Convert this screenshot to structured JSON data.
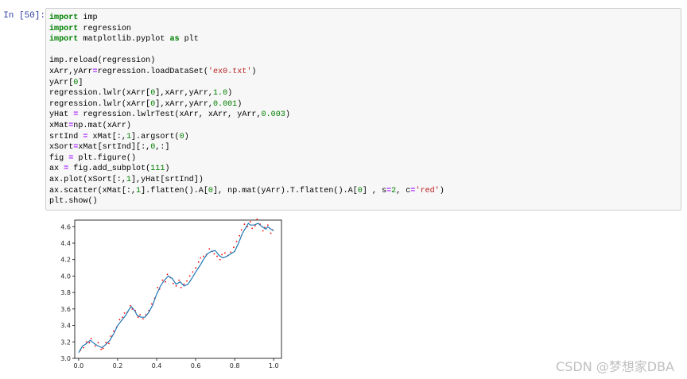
{
  "cell": {
    "prompt": "In  [50]:",
    "code_lines": [
      [
        {
          "t": "import",
          "c": "kw"
        },
        {
          "t": " imp"
        }
      ],
      [
        {
          "t": "import",
          "c": "kw"
        },
        {
          "t": " regression"
        }
      ],
      [
        {
          "t": "import",
          "c": "kw"
        },
        {
          "t": " matplotlib.pyplot "
        },
        {
          "t": "as",
          "c": "kw"
        },
        {
          "t": " plt"
        }
      ],
      [],
      [
        {
          "t": "imp.reload(regression)"
        }
      ],
      [
        {
          "t": "xArr,yArr"
        },
        {
          "t": "=",
          "c": "op"
        },
        {
          "t": "regression.loadDataSet("
        },
        {
          "t": "'ex0.txt'",
          "c": "str"
        },
        {
          "t": ")"
        }
      ],
      [
        {
          "t": "yArr["
        },
        {
          "t": "0",
          "c": "num"
        },
        {
          "t": "]"
        }
      ],
      [
        {
          "t": "regression.lwlr(xArr["
        },
        {
          "t": "0",
          "c": "num"
        },
        {
          "t": "],xArr,yArr,"
        },
        {
          "t": "1.0",
          "c": "num"
        },
        {
          "t": ")"
        }
      ],
      [
        {
          "t": "regression.lwlr(xArr["
        },
        {
          "t": "0",
          "c": "num"
        },
        {
          "t": "],xArr,yArr,"
        },
        {
          "t": "0.001",
          "c": "num"
        },
        {
          "t": ")"
        }
      ],
      [
        {
          "t": "yHat "
        },
        {
          "t": "=",
          "c": "op"
        },
        {
          "t": " regression.lwlrTest(xArr, xArr, yArr,"
        },
        {
          "t": "0.003",
          "c": "num"
        },
        {
          "t": ")"
        }
      ],
      [
        {
          "t": "xMat"
        },
        {
          "t": "=",
          "c": "op"
        },
        {
          "t": "np.mat(xArr)"
        }
      ],
      [
        {
          "t": "srtInd "
        },
        {
          "t": "=",
          "c": "op"
        },
        {
          "t": " xMat[:,"
        },
        {
          "t": "1",
          "c": "num"
        },
        {
          "t": "].argsort("
        },
        {
          "t": "0",
          "c": "num"
        },
        {
          "t": ")"
        }
      ],
      [
        {
          "t": "xSort"
        },
        {
          "t": "=",
          "c": "op"
        },
        {
          "t": "xMat[srtInd][:,"
        },
        {
          "t": "0",
          "c": "num"
        },
        {
          "t": ",:]"
        }
      ],
      [
        {
          "t": "fig "
        },
        {
          "t": "=",
          "c": "op"
        },
        {
          "t": " plt.figure()"
        }
      ],
      [
        {
          "t": "ax "
        },
        {
          "t": "=",
          "c": "op"
        },
        {
          "t": " fig.add_subplot("
        },
        {
          "t": "111",
          "c": "num"
        },
        {
          "t": ")"
        }
      ],
      [
        {
          "t": "ax.plot(xSort[:,"
        },
        {
          "t": "1",
          "c": "num"
        },
        {
          "t": "],yHat[srtInd])"
        }
      ],
      [
        {
          "t": "ax.scatter(xMat[:,"
        },
        {
          "t": "1",
          "c": "num"
        },
        {
          "t": "].flatten().A["
        },
        {
          "t": "0",
          "c": "num"
        },
        {
          "t": "], np.mat(yArr).T.flatten().A["
        },
        {
          "t": "0",
          "c": "num"
        },
        {
          "t": "] , s"
        },
        {
          "t": "=",
          "c": "op"
        },
        {
          "t": "2",
          "c": "num"
        },
        {
          "t": ", c"
        },
        {
          "t": "=",
          "c": "op"
        },
        {
          "t": "'red'",
          "c": "str"
        },
        {
          "t": ")"
        }
      ],
      [
        {
          "t": "plt.show()"
        }
      ]
    ]
  },
  "chart_data": {
    "type": "line",
    "xlim": [
      -0.02,
      1.04
    ],
    "ylim": [
      3.0,
      4.68
    ],
    "xticks": [
      "0.0",
      "0.2",
      "0.4",
      "0.6",
      "0.8",
      "1.0"
    ],
    "xtick_values": [
      0.0,
      0.2,
      0.4,
      0.6,
      0.8,
      1.0
    ],
    "yticks": [
      "3.0",
      "3.2",
      "3.4",
      "3.6",
      "3.8",
      "4.0",
      "4.2",
      "4.4",
      "4.6"
    ],
    "ytick_values": [
      3.0,
      3.2,
      3.4,
      3.6,
      3.8,
      4.0,
      4.2,
      4.4,
      4.6
    ],
    "line_color": "#1f77b4",
    "scatter_color": "red",
    "series": [
      {
        "type": "line",
        "x": [
          0.0,
          0.02,
          0.04,
          0.06,
          0.07,
          0.08,
          0.1,
          0.12,
          0.14,
          0.16,
          0.18,
          0.2,
          0.22,
          0.24,
          0.26,
          0.27,
          0.28,
          0.29,
          0.3,
          0.32,
          0.34,
          0.36,
          0.38,
          0.4,
          0.42,
          0.44,
          0.46,
          0.48,
          0.5,
          0.52,
          0.54,
          0.56,
          0.58,
          0.6,
          0.62,
          0.64,
          0.66,
          0.68,
          0.7,
          0.71,
          0.72,
          0.74,
          0.76,
          0.78,
          0.8,
          0.82,
          0.84,
          0.86,
          0.87,
          0.88,
          0.9,
          0.92,
          0.94,
          0.96,
          0.97,
          0.98,
          1.0
        ],
        "y": [
          3.07,
          3.15,
          3.18,
          3.22,
          3.2,
          3.18,
          3.15,
          3.13,
          3.17,
          3.22,
          3.3,
          3.4,
          3.46,
          3.52,
          3.6,
          3.63,
          3.6,
          3.57,
          3.52,
          3.5,
          3.5,
          3.56,
          3.65,
          3.78,
          3.88,
          3.95,
          4.0,
          3.97,
          3.9,
          3.93,
          3.88,
          3.9,
          3.97,
          4.05,
          4.12,
          4.2,
          4.27,
          4.3,
          4.31,
          4.28,
          4.25,
          4.22,
          4.24,
          4.27,
          4.3,
          4.4,
          4.52,
          4.6,
          4.64,
          4.62,
          4.62,
          4.64,
          4.6,
          4.57,
          4.6,
          4.58,
          4.55
        ]
      },
      {
        "type": "scatter",
        "x": [
          0.01,
          0.025,
          0.04,
          0.055,
          0.065,
          0.085,
          0.1,
          0.115,
          0.125,
          0.14,
          0.155,
          0.165,
          0.18,
          0.195,
          0.21,
          0.225,
          0.235,
          0.25,
          0.265,
          0.275,
          0.29,
          0.305,
          0.315,
          0.33,
          0.345,
          0.36,
          0.375,
          0.39,
          0.405,
          0.415,
          0.43,
          0.445,
          0.455,
          0.47,
          0.485,
          0.5,
          0.515,
          0.525,
          0.54,
          0.555,
          0.57,
          0.585,
          0.6,
          0.615,
          0.625,
          0.64,
          0.655,
          0.67,
          0.685,
          0.695,
          0.71,
          0.725,
          0.735,
          0.75,
          0.765,
          0.78,
          0.795,
          0.81,
          0.825,
          0.835,
          0.85,
          0.865,
          0.88,
          0.89,
          0.905,
          0.915,
          0.93,
          0.945,
          0.955,
          0.97,
          0.985,
          0.995
        ],
        "y": [
          3.1,
          3.13,
          3.2,
          3.19,
          3.24,
          3.15,
          3.19,
          3.11,
          3.12,
          3.19,
          3.18,
          3.27,
          3.33,
          3.38,
          3.47,
          3.5,
          3.55,
          3.56,
          3.64,
          3.6,
          3.58,
          3.5,
          3.53,
          3.48,
          3.53,
          3.58,
          3.66,
          3.73,
          3.86,
          3.84,
          3.95,
          3.93,
          4.02,
          3.98,
          3.91,
          3.88,
          3.95,
          3.86,
          3.9,
          3.94,
          4.0,
          4.05,
          4.1,
          4.17,
          4.22,
          4.24,
          4.26,
          4.33,
          4.3,
          4.27,
          4.24,
          4.2,
          4.26,
          4.28,
          4.25,
          4.29,
          4.35,
          4.42,
          4.49,
          4.56,
          4.63,
          4.6,
          4.66,
          4.58,
          4.61,
          4.69,
          4.63,
          4.55,
          4.59,
          4.62,
          4.52,
          4.56
        ]
      }
    ]
  },
  "watermark": "CSDN @梦想家DBA"
}
